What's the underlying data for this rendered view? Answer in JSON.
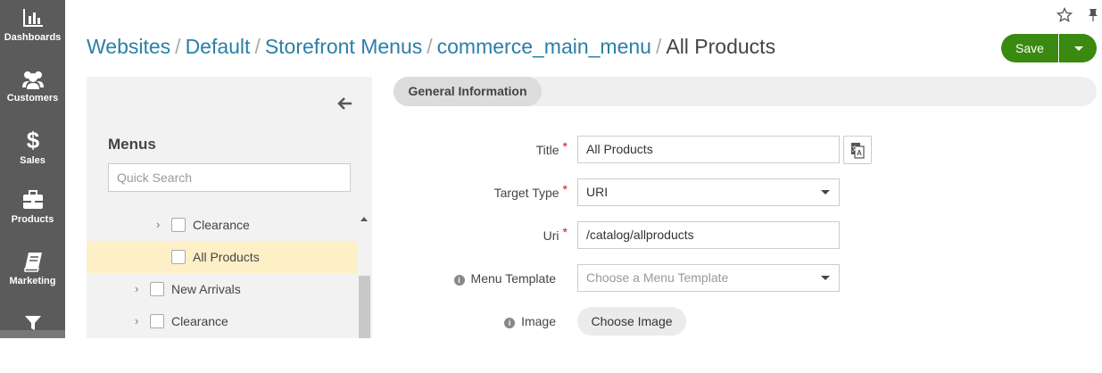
{
  "nav": {
    "items": [
      {
        "label": "Dashboards",
        "icon": "dashboards-icon"
      },
      {
        "label": "Customers",
        "icon": "customers-icon"
      },
      {
        "label": "Sales",
        "icon": "dollar-icon"
      },
      {
        "label": "Products",
        "icon": "briefcase-icon"
      },
      {
        "label": "Marketing",
        "icon": "book-icon"
      },
      {
        "label": "",
        "icon": "funnel-icon"
      }
    ]
  },
  "breadcrumb": {
    "links": [
      "Websites",
      "Default",
      "Storefront Menus",
      "commerce_main_menu"
    ],
    "separator": "/",
    "current": "All Products"
  },
  "actions": {
    "save_label": "Save"
  },
  "sidebar": {
    "title": "Menus",
    "search_placeholder": "Quick Search",
    "tree": [
      {
        "label": "Clearance",
        "expandable": true,
        "level": 2,
        "selected": false
      },
      {
        "label": "All Products",
        "expandable": false,
        "level": 2,
        "selected": true
      },
      {
        "label": "New Arrivals",
        "expandable": true,
        "level": 1,
        "selected": false
      },
      {
        "label": "Clearance",
        "expandable": true,
        "level": 1,
        "selected": false
      }
    ]
  },
  "section": {
    "tab_label": "General Information"
  },
  "form": {
    "title_label": "Title",
    "title_value": "All Products",
    "target_type_label": "Target Type",
    "target_type_value": "URI",
    "uri_label": "Uri",
    "uri_value": "/catalog/allproducts",
    "menu_template_label": "Menu Template",
    "menu_template_placeholder": "Choose a Menu Template",
    "image_label": "Image",
    "choose_image_label": "Choose Image",
    "required_mark": "*",
    "info_mark": "i"
  },
  "colors": {
    "nav_bg": "#5b5b5b",
    "link": "#2a7fa6",
    "save_green": "#3a8a12",
    "selected_row": "#fdf0c6",
    "required": "#c81a1a"
  }
}
